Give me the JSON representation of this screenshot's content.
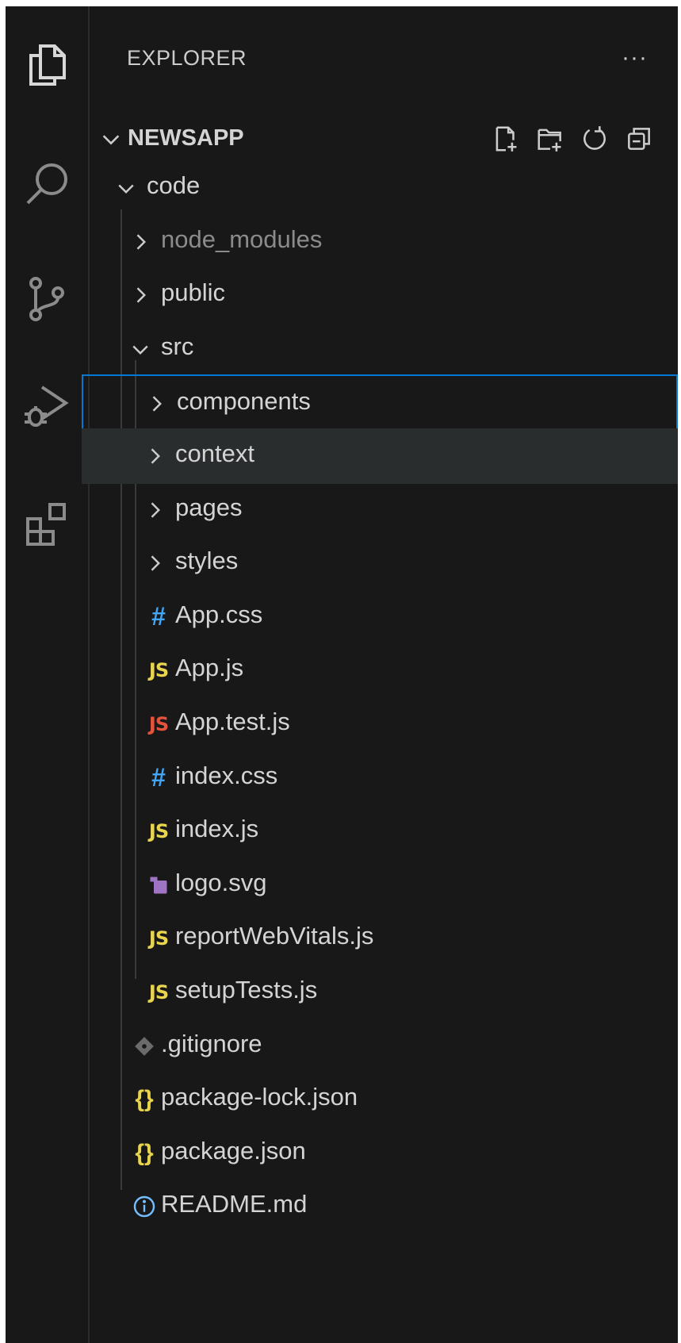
{
  "activity_bar": {
    "items": [
      {
        "name": "explorer",
        "icon": "files-icon"
      },
      {
        "name": "search",
        "icon": "search-icon"
      },
      {
        "name": "source-control",
        "icon": "source-control-icon"
      },
      {
        "name": "run-debug",
        "icon": "run-debug-icon"
      },
      {
        "name": "extensions",
        "icon": "extensions-icon"
      }
    ]
  },
  "sidebar": {
    "title": "EXPLORER",
    "more": "···",
    "section": {
      "title": "NEWSAPP",
      "actions": [
        "new-file-icon",
        "new-folder-icon",
        "refresh-icon",
        "collapse-all-icon"
      ]
    },
    "tree": [
      {
        "label": "code",
        "type": "folder",
        "expanded": true,
        "depth": 0
      },
      {
        "label": "node_modules",
        "type": "folder",
        "expanded": false,
        "depth": 1,
        "dim": true
      },
      {
        "label": "public",
        "type": "folder",
        "expanded": false,
        "depth": 1
      },
      {
        "label": "src",
        "type": "folder",
        "expanded": true,
        "depth": 1
      },
      {
        "label": "components",
        "type": "folder",
        "expanded": false,
        "depth": 2,
        "selected": true
      },
      {
        "label": "context",
        "type": "folder",
        "expanded": false,
        "depth": 2,
        "hover": true
      },
      {
        "label": "pages",
        "type": "folder",
        "expanded": false,
        "depth": 2
      },
      {
        "label": "styles",
        "type": "folder",
        "expanded": false,
        "depth": 2
      },
      {
        "label": "App.css",
        "type": "css",
        "badge": "#",
        "depth": 2
      },
      {
        "label": "App.js",
        "type": "js",
        "badge": "JS",
        "depth": 2
      },
      {
        "label": "App.test.js",
        "type": "test-js",
        "badge": "JS",
        "depth": 2
      },
      {
        "label": "index.css",
        "type": "css",
        "badge": "#",
        "depth": 2
      },
      {
        "label": "index.js",
        "type": "js",
        "badge": "JS",
        "depth": 2
      },
      {
        "label": "logo.svg",
        "type": "svg",
        "depth": 2
      },
      {
        "label": "reportWebVitals.js",
        "type": "js",
        "badge": "JS",
        "depth": 2
      },
      {
        "label": "setupTests.js",
        "type": "js",
        "badge": "JS",
        "depth": 2
      },
      {
        "label": ".gitignore",
        "type": "git",
        "depth": 1
      },
      {
        "label": "package-lock.json",
        "type": "json",
        "badge": "{}",
        "depth": 1
      },
      {
        "label": "package.json",
        "type": "json",
        "badge": "{}",
        "depth": 1
      },
      {
        "label": "README.md",
        "type": "info",
        "depth": 1
      }
    ]
  },
  "colors": {
    "background": "#181818",
    "selection_border": "#0078d4",
    "hover": "#2a2d2e",
    "js": "#e8d44d",
    "test_js": "#e6533c",
    "css": "#42a5f5",
    "svg": "#a074c4",
    "git": "#6b6b6b",
    "info": "#75beff"
  }
}
